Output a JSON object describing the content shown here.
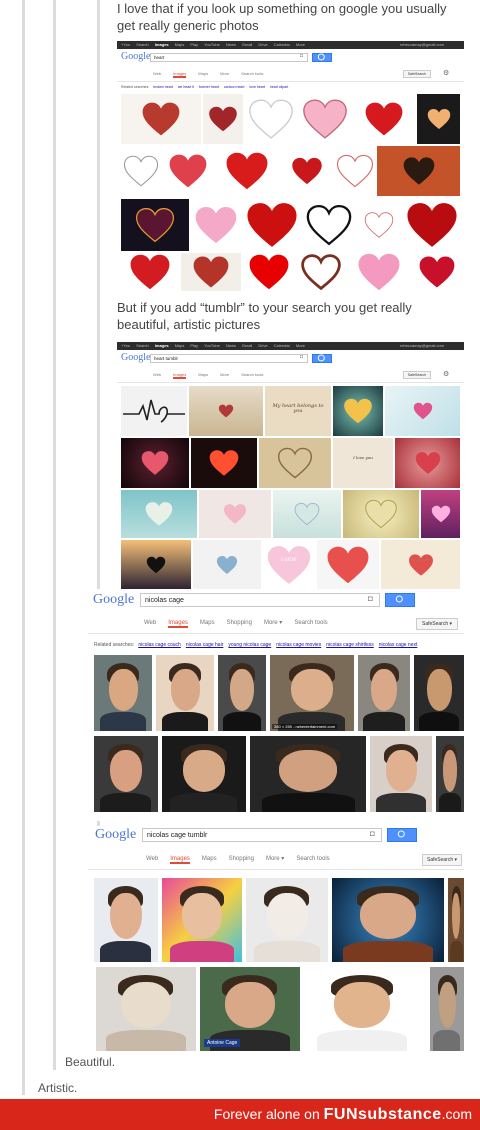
{
  "post": {
    "text_1": "I love that if you look up something on google you usually get really generic photos",
    "text_2": "But if you add “tumblr” to your search you get really beautiful, artistic pictures",
    "reply_beautiful": "Beautiful.",
    "reply_artistic": "Artistic."
  },
  "screenshots": {
    "heart": {
      "logo": "Google",
      "query": "heart",
      "topbar_items": [
        "+You",
        "Search",
        "Images",
        "Maps",
        "Play",
        "YouTube",
        "News",
        "Gmail",
        "Drive",
        "Calendar",
        "More"
      ],
      "topbar_active": "Images",
      "account": "rebeccamay@gmail.com",
      "tabs": [
        "Web",
        "Images",
        "Maps",
        "More",
        "Search tools"
      ],
      "active_tab": "Images",
      "safesearch": "SafeSearch",
      "related_label": "Related searches:",
      "related": [
        "broken heart",
        "we heart it",
        "forever heart",
        "cartoon heart",
        "love heart",
        "heart clipart"
      ]
    },
    "heart_tumblr": {
      "logo": "Google",
      "query": "heart tumblr",
      "topbar_items": [
        "+You",
        "Search",
        "Images",
        "Maps",
        "Play",
        "YouTube",
        "News",
        "Gmail",
        "Drive",
        "Calendar",
        "More"
      ],
      "topbar_active": "Images",
      "account": "rebeccamay@gmail.com",
      "tabs": [
        "Web",
        "Images",
        "Maps",
        "More",
        "Search tools"
      ],
      "active_tab": "Images",
      "safesearch": "SafeSearch",
      "tile_texts": [
        "My heart belongs to you",
        "I love you",
        "I HOE",
        "my heart"
      ]
    },
    "nicolas_cage": {
      "logo": "Google",
      "query": "nicolas cage",
      "tabs": [
        "Web",
        "Images",
        "Maps",
        "Shopping",
        "More ▾",
        "Search tools"
      ],
      "active_tab": "Images",
      "safesearch": "SafeSearch ▾",
      "related_label": "Related searches:",
      "related": [
        "nicolas cage couch",
        "nicolas cage hair",
        "young nicolas cage",
        "nicolas cage movies",
        "nicolas cage shirtless",
        "nicolas cage next"
      ],
      "image_caption": "380 × 255 - nzbentertainment.com"
    },
    "nicolas_cage_tumblr": {
      "logo": "Google",
      "query": "nicolas cage tumblr",
      "tabs": [
        "Web",
        "Images",
        "Maps",
        "Shopping",
        "More ▾",
        "Search tools"
      ],
      "active_tab": "Images",
      "safesearch": "SafeSearch ▾",
      "image_caption": "Antoine Cage"
    }
  },
  "watermark": {
    "prefix": "Forever alone on ",
    "brand": "FUNsubstance",
    "suffix": ".com"
  },
  "colors": {
    "google_blue": "#4d90fe",
    "tab_red": "#dd4b39",
    "footer_red": "#d8261b",
    "heart_red": "#d6191f",
    "heart_pink": "#f4a9c8"
  }
}
